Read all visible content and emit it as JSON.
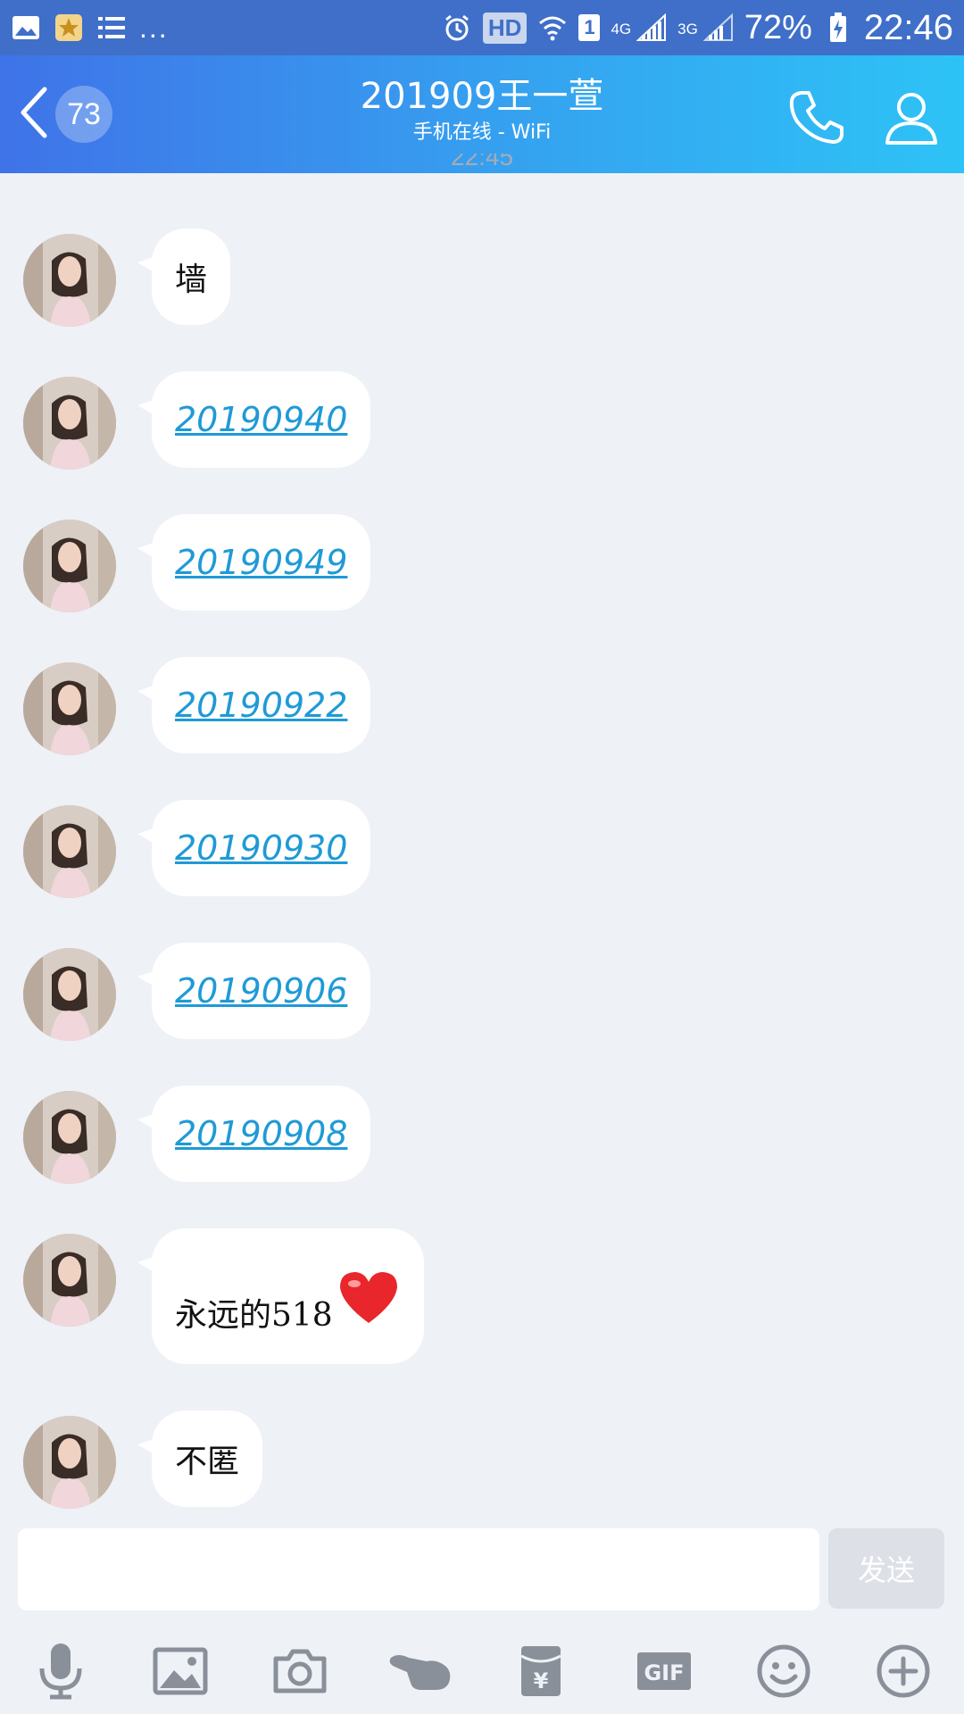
{
  "status_bar": {
    "more": "...",
    "hd": "HD",
    "sim": "1",
    "net1": "4G",
    "net2": "3G",
    "battery": "72%",
    "time": "22:46"
  },
  "header": {
    "unread_count": "73",
    "title": "201909王一萱",
    "subtitle": "手机在线 - WiFi"
  },
  "timestamp": "22:45",
  "messages": [
    {
      "text": "墙",
      "is_link": false
    },
    {
      "text": "20190940",
      "is_link": true
    },
    {
      "text": "20190949",
      "is_link": true
    },
    {
      "text": "20190922",
      "is_link": true
    },
    {
      "text": "20190930",
      "is_link": true
    },
    {
      "text": "20190906",
      "is_link": true
    },
    {
      "text": "20190908",
      "is_link": true
    },
    {
      "text": "永远的518",
      "is_link": false,
      "emoji": "heart"
    },
    {
      "text": "不匿",
      "is_link": false
    }
  ],
  "composer": {
    "input_value": "",
    "send_label": "发送"
  },
  "toolbar": {
    "gif_label": "GIF",
    "tools": [
      "microphone-icon",
      "image-icon",
      "camera-icon",
      "poke-icon",
      "red-packet-icon",
      "gif-icon",
      "emoji-icon",
      "plus-icon"
    ]
  },
  "colors": {
    "status_bar": "#3f6fc9",
    "header_start": "#3f73e8",
    "header_end": "#2dc3f6",
    "background": "#eef1f6",
    "link": "#1f9ad6",
    "heart": "#e8262c",
    "toolbar_icon": "#8a9099"
  }
}
